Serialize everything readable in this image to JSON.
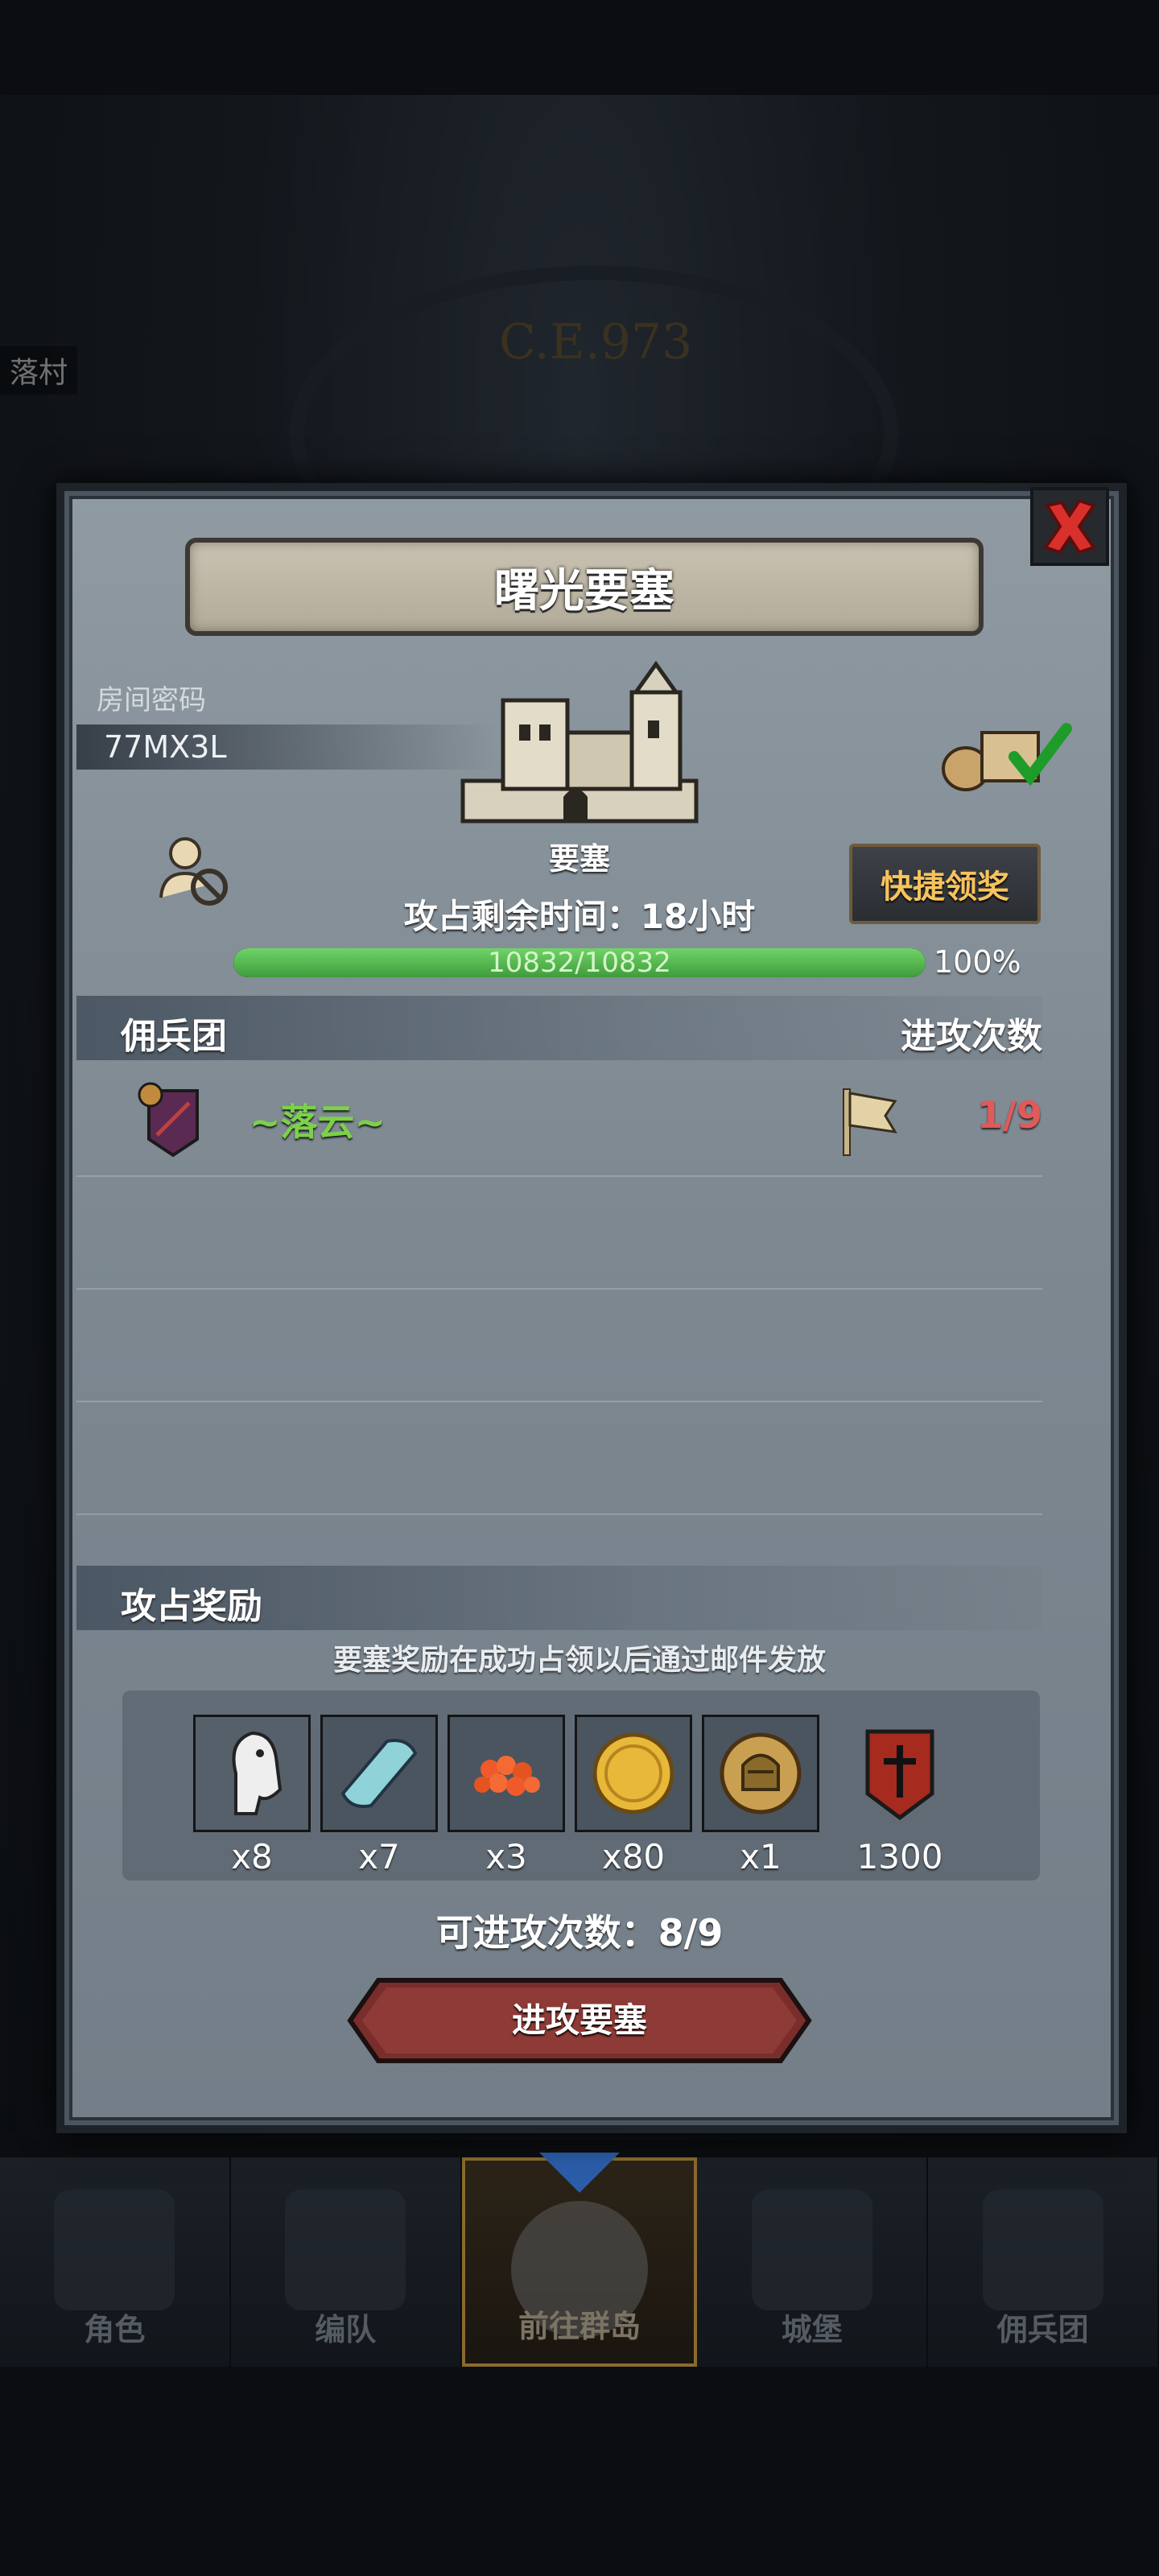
{
  "background": {
    "year_label": "C.E.973",
    "village_label": "落村"
  },
  "modal": {
    "title": "曙光要塞",
    "room_password_label": "房间密码",
    "room_password": "77MX3L",
    "fortress_type": "要塞",
    "time_remaining": "攻占剩余时间：18小时",
    "quick_claim_label": "快捷领奖",
    "progress": {
      "current": 10832,
      "max": 10832,
      "text": "10832/10832",
      "percent_text": "100%",
      "fraction": 1.0
    },
    "mercenary_section": {
      "left_title": "佣兵团",
      "right_title": "进攻次数",
      "rows": [
        {
          "name": "~落云~",
          "attacks": "1/9"
        }
      ]
    },
    "reward_section": {
      "title": "攻占奖励",
      "note": "要塞奖励在成功占领以后通过邮件发放",
      "items": [
        {
          "icon": "horse-icon",
          "qty": "x8"
        },
        {
          "icon": "cloth-icon",
          "qty": "x7"
        },
        {
          "icon": "caviar-icon",
          "qty": "x3"
        },
        {
          "icon": "gold-coin-icon",
          "qty": "x80"
        },
        {
          "icon": "knight-helmet-coin-icon",
          "qty": "x1"
        },
        {
          "icon": "guild-banner-icon",
          "qty": "1300"
        }
      ]
    },
    "attempts_text": "可进攻次数：8/9",
    "attack_button_label": "进攻要塞"
  },
  "bottom_nav": [
    {
      "label": "角色",
      "active": false
    },
    {
      "label": "编队",
      "active": false
    },
    {
      "label": "前往群岛",
      "active": true
    },
    {
      "label": "城堡",
      "active": false
    },
    {
      "label": "佣兵团",
      "active": false
    }
  ],
  "colors": {
    "accent_gold": "#f7c35c",
    "progress_green": "#5cc456",
    "merc_name_green": "#7cd04c",
    "attack_count_red": "#e05a5a",
    "attack_button": "#8a3a3a"
  }
}
